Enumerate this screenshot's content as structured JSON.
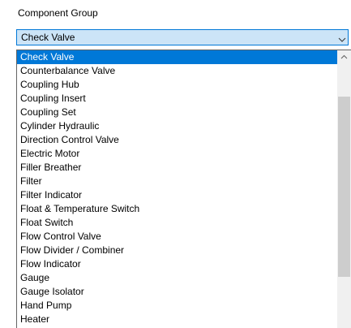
{
  "field": {
    "label": "Component Group",
    "selected_value": "Check Valve",
    "arrow_icon": "chevron-down-icon"
  },
  "dropdown": {
    "items": [
      "Check Valve",
      "Counterbalance Valve",
      "Coupling Hub",
      "Coupling Insert",
      "Coupling Set",
      "Cylinder Hydraulic",
      "Direction Control Valve",
      "Electric Motor",
      "Filler Breather",
      "Filter",
      "Filter Indicator",
      "Float & Temperature Switch",
      "Float Switch",
      "Flow Control Valve",
      "Flow Divider / Combiner",
      "Flow Indicator",
      "Gauge",
      "Gauge Isolator",
      "Hand Pump",
      "Heater"
    ],
    "selected_index": 0,
    "scroll_up_icon": "chevron-up-icon"
  },
  "colors": {
    "selection": "#0078d7",
    "combo_background": "#cce4f7",
    "scrollbar_track": "#f0f0f0",
    "scrollbar_thumb": "#cdcdcd"
  }
}
